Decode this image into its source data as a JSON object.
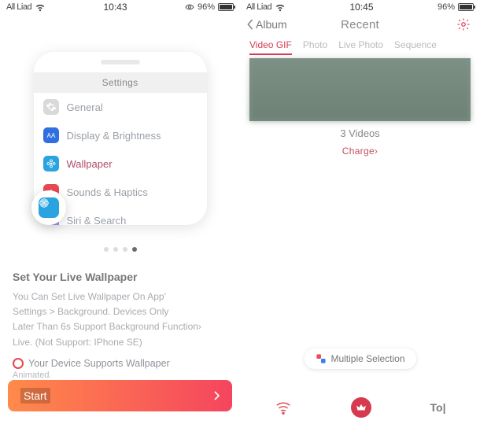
{
  "left": {
    "status": {
      "carrier": "All Liad",
      "time": "10:43",
      "battery_pct": "96%"
    },
    "phone": {
      "settings_title": "Settings",
      "rows": {
        "general": "General",
        "display": "Display & Brightness",
        "wallpaper": "Wallpaper",
        "sounds": "Sounds & Haptics",
        "siri": "Siri & Search"
      }
    },
    "page_indicator": {
      "count": 4,
      "active": 4
    },
    "heading": "Set Your Live Wallpaper",
    "body_l1": "You Can Set Live Wallpaper On App'",
    "body_l2": "Settings > Background. Devices Only",
    "body_l3": "Later Than 6s Support Background Function›",
    "body_l4": "Live. (Not Support: IPhone SE)",
    "support_line": "Your Device Supports Wallpaper",
    "animated": "Animated.",
    "start_label": "Start"
  },
  "right": {
    "status": {
      "carrier": "All Liad",
      "time": "10:45",
      "battery_pct": "96%"
    },
    "nav": {
      "back": "Album",
      "title": "Recent"
    },
    "tabs": {
      "video": "Video",
      "gif": "GIF",
      "photo": "Photo",
      "live": "Live Photo",
      "seq": "Sequence"
    },
    "count": "3 Videos",
    "charge": "Charge›",
    "multi_select": "Multiple Selection",
    "bottom_right_text": "To|"
  }
}
